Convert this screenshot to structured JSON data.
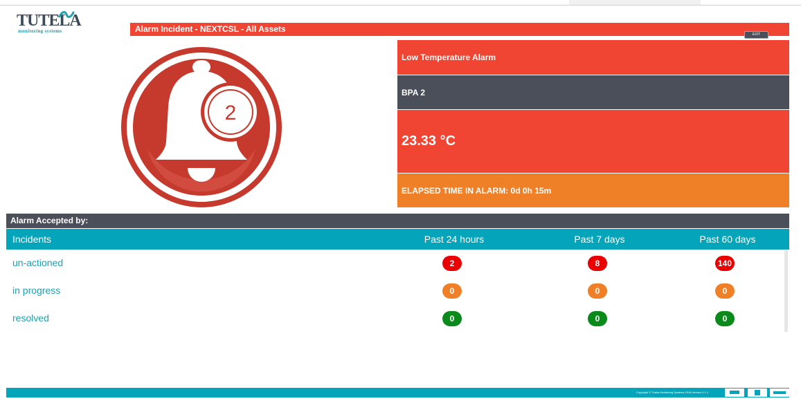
{
  "brand": {
    "name": "TUTELA",
    "tagline": "monitoring systems"
  },
  "header": {
    "title": "Alarm Incident  -  NEXTCSL  -  All Assets",
    "exit_label": "EXIT"
  },
  "bell": {
    "count": "2"
  },
  "alarm": {
    "type": "Low Temperature Alarm",
    "asset": "BPA 2",
    "value": "23.33 °C",
    "elapsed": "ELAPSED TIME IN ALARM: 0d 0h 15m"
  },
  "accepted": {
    "label": "Alarm Accepted by:"
  },
  "table": {
    "headers": [
      "Incidents",
      "Past 24 hours",
      "Past 7 days",
      "Past 60 days"
    ],
    "rows": [
      {
        "label": "un-actioned",
        "values": [
          "2",
          "8",
          "140"
        ]
      },
      {
        "label": "in progress",
        "values": [
          "0",
          "0",
          "0"
        ]
      },
      {
        "label": "resolved",
        "values": [
          "0",
          "0",
          "0"
        ]
      }
    ]
  },
  "footer": {
    "copyright": "Copyright © Tutela Monitoring Systems 2016-Version 4.1.1"
  },
  "colors": {
    "alarm_red": "#f04533",
    "dark_slate": "#4a4f5a",
    "orange": "#f08028",
    "teal": "#04a5ba",
    "badge_red": "#ea0000",
    "badge_orange": "#f08028",
    "badge_green": "#0a8a1a"
  },
  "icons": [
    "bell-icon",
    "monitor-icon",
    "tablet-icon",
    "window-icon"
  ]
}
